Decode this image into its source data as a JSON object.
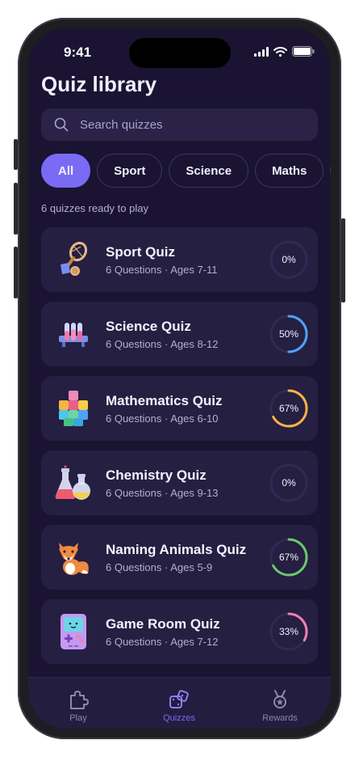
{
  "status": {
    "time": "9:41"
  },
  "title": "Quiz library",
  "search": {
    "placeholder": "Search quizzes",
    "value": ""
  },
  "chips": [
    "All",
    "Sport",
    "Science",
    "Maths"
  ],
  "summary": "6 quizzes ready to play",
  "quizzes": [
    {
      "name": "Sport Quiz",
      "meta": "6 Questions · Ages 7-11",
      "progress_label": "0%",
      "progress": 0,
      "color": "#8b86b0",
      "icon": "badminton-icon"
    },
    {
      "name": "Science Quiz",
      "meta": "6 Questions · Ages 8-12",
      "progress_label": "50%",
      "progress": 0.5,
      "color": "#4fa3f7",
      "icon": "test-tubes-icon"
    },
    {
      "name": "Mathematics Quiz",
      "meta": "6 Questions · Ages 6-10",
      "progress_label": "67%",
      "progress": 0.67,
      "color": "#f5b443",
      "icon": "cubes-icon"
    },
    {
      "name": "Chemistry Quiz",
      "meta": "6 Questions · Ages 9-13",
      "progress_label": "0%",
      "progress": 0,
      "color": "#8b86b0",
      "icon": "flasks-icon"
    },
    {
      "name": "Naming Animals Quiz",
      "meta": "6 Questions · Ages 5-9",
      "progress_label": "67%",
      "progress": 0.67,
      "color": "#6cc86a",
      "icon": "fox-icon"
    },
    {
      "name": "Game Room Quiz",
      "meta": "6 Questions · Ages 7-12",
      "progress_label": "33%",
      "progress": 0.33,
      "color": "#f47fb4",
      "icon": "gameboy-icon"
    }
  ],
  "tabs": [
    {
      "label": "Play",
      "icon": "puzzle-icon",
      "active": false
    },
    {
      "label": "Quizzes",
      "icon": "dice-icon",
      "active": true
    },
    {
      "label": "Rewards",
      "icon": "medal-icon",
      "active": false
    }
  ],
  "colors": {
    "background": "#1a1432",
    "card": "#251f42",
    "accent": "#7a6bf5",
    "inactive_tab": "#8d87b0"
  }
}
